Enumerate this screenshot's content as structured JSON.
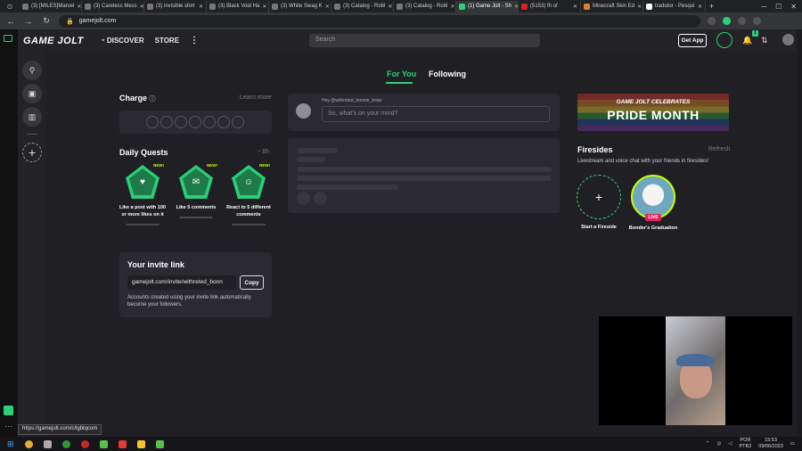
{
  "browser": {
    "tabs": [
      {
        "label": "(3) [MILES]Marvel"
      },
      {
        "label": "(3) Careless Mess"
      },
      {
        "label": "(3) invisible shirt"
      },
      {
        "label": "(3) Black Void Ha"
      },
      {
        "label": "(3) White Swag K"
      },
      {
        "label": "(3) Catalog - Robl"
      },
      {
        "label": "(3) Catalog - Robl"
      },
      {
        "label": "(1) Game Jolt - Sh"
      },
      {
        "label": "(5153) fh of"
      },
      {
        "label": "Minecraft Skin Ed"
      },
      {
        "label": "tradutor - Pesqui"
      }
    ],
    "url": "gamejolt.com",
    "status_url": "https://gamejolt.com/c/lgbtqcom"
  },
  "header": {
    "logo": "GAME JOLT",
    "discover": "DISCOVER",
    "store": "STORE",
    "search_placeholder": "Search",
    "get_app": "Get App",
    "notif_count": "1"
  },
  "feed": {
    "tab_for_you": "For You",
    "tab_following": "Following",
    "post_greeting": "Hey @withreted_bonnie_bolat",
    "post_placeholder": "So, what's on your mind?"
  },
  "charge": {
    "title": "Charge",
    "learn_more": "Learn more"
  },
  "quests": {
    "title": "Daily Quests",
    "timer": "8h",
    "items": [
      {
        "badge": "NEW!",
        "label": "Like a post with 100 or more likes on it"
      },
      {
        "badge": "NEW!",
        "label": "Like 5 comments"
      },
      {
        "badge": "NEW!",
        "label": "React to 5 different comments"
      }
    ]
  },
  "invite": {
    "title": "Your invite link",
    "link": "gamejolt.com/invite/withreted_bonn",
    "copy": "Copy",
    "note": "Accounts created using your invite link automatically become your followers."
  },
  "banner": {
    "line1": "GAME JOLT CELEBRATES",
    "line2": "PRIDE MONTH"
  },
  "firesides": {
    "title": "Firesides",
    "refresh": "Refresh",
    "desc": "Livestream and voice chat with your friends in firesides!",
    "start": "Start a Fireside",
    "live_badge": "LIVE",
    "live_name": "Bonder's Graduation"
  },
  "taskbar": {
    "lang": "POR",
    "layout": "PTB2",
    "time": "15:53",
    "date": "09/06/2023"
  },
  "colors": {
    "accent": "#2ecf7a",
    "lime": "#ccff00",
    "bg": "#201f23"
  }
}
